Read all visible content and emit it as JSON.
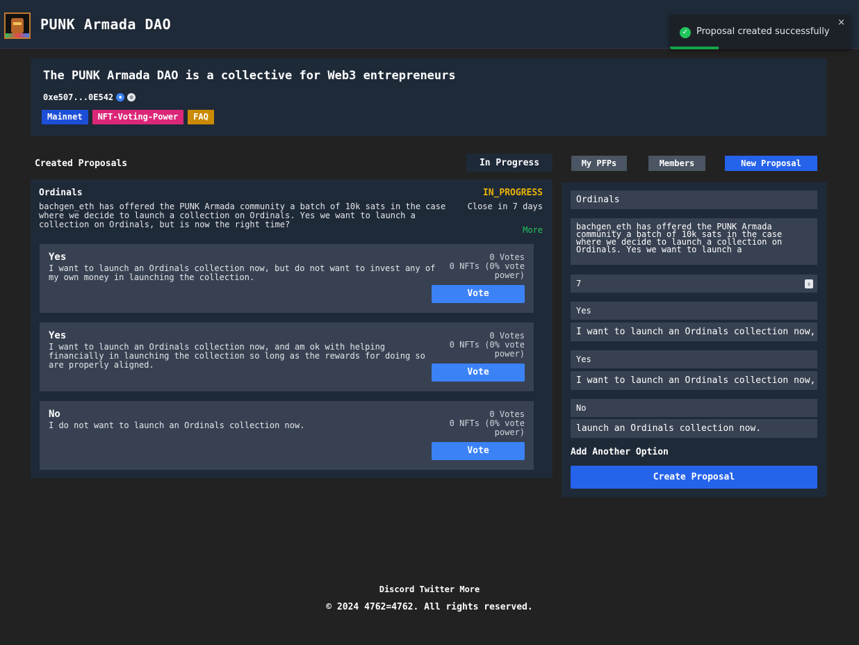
{
  "header": {
    "app_title": "PUNK Armada DAO",
    "logo_icon": "punk-avatar-icon"
  },
  "toast": {
    "message": "Proposal created successfully",
    "close": "×",
    "icon": "check-circle-icon",
    "progress_percent": 27
  },
  "dao": {
    "headline": "The PUNK Armada DAO is a collective for Web3 entrepreneurs",
    "address": "0xe507...0E542",
    "address_icons": [
      "ethereum-icon",
      "globe-icon"
    ],
    "tags": [
      "Mainnet",
      "NFT-Voting-Power",
      "FAQ"
    ]
  },
  "proposals": {
    "section_title": "Created Proposals",
    "filter_label": "In Progress",
    "item": {
      "title": "Ordinals",
      "description": "bachgen_eth has offered the PUNK Armada community a batch of 10k sats in the case where we decide to launch a collection on Ordinals. Yes we want to launch a collection on Ordinals, but is now the right time?",
      "status": "IN_PROGRESS",
      "close_text": "Close in 7 days",
      "more_label": "More",
      "options": [
        {
          "title": "Yes",
          "description": "I want to launch an Ordinals collection now, but do not want to invest any of my own money in launching the collection.",
          "votes": "0 Votes",
          "nfts": "0 NFTs (0% vote power)",
          "vote_label": "Vote"
        },
        {
          "title": "Yes",
          "description": "I want to launch an Ordinals collection now, and am ok with helping financially in launching the collection so long as the rewards for doing so are properly aligned.",
          "votes": "0 Votes",
          "nfts": "0 NFTs (0% vote power)",
          "vote_label": "Vote"
        },
        {
          "title": "No",
          "description": "I do not want to launch an Ordinals collection now.",
          "votes": "0 Votes",
          "nfts": "0 NFTs (0% vote power)",
          "vote_label": "Vote"
        }
      ]
    }
  },
  "tabs": {
    "my_pfps": "My PFPs",
    "members": "Members",
    "new_proposal": "New Proposal"
  },
  "form": {
    "title_value": "Ordinals",
    "description_value": "bachgen_eth has offered the PUNK Armada community a batch of 10k sats in the case where we decide to launch a collection on Ordinals. Yes we want to launch a",
    "duration_value": "7",
    "option_1_title": "Yes",
    "option_1_desc": "I want to launch an Ordinals collection now, but do not want to invest",
    "option_2_title": "Yes",
    "option_2_desc": "I want to launch an Ordinals collection now, and am ok",
    "option_3_title": "No",
    "option_3_desc": "launch an Ordinals collection now.",
    "add_option_label": "Add Another Option",
    "create_label": "Create Proposal"
  },
  "footer": {
    "links": [
      "Discord",
      "Twitter",
      "More"
    ],
    "copyright": "© 2024 4762=4762. All rights reserved."
  },
  "colors": {
    "page_bg": "#222222",
    "card_bg": "#1f2a38",
    "option_bg": "#374151",
    "status_yellow": "#eab308",
    "accent_green": "#22c55e",
    "button_blue": "#3b82f6"
  }
}
